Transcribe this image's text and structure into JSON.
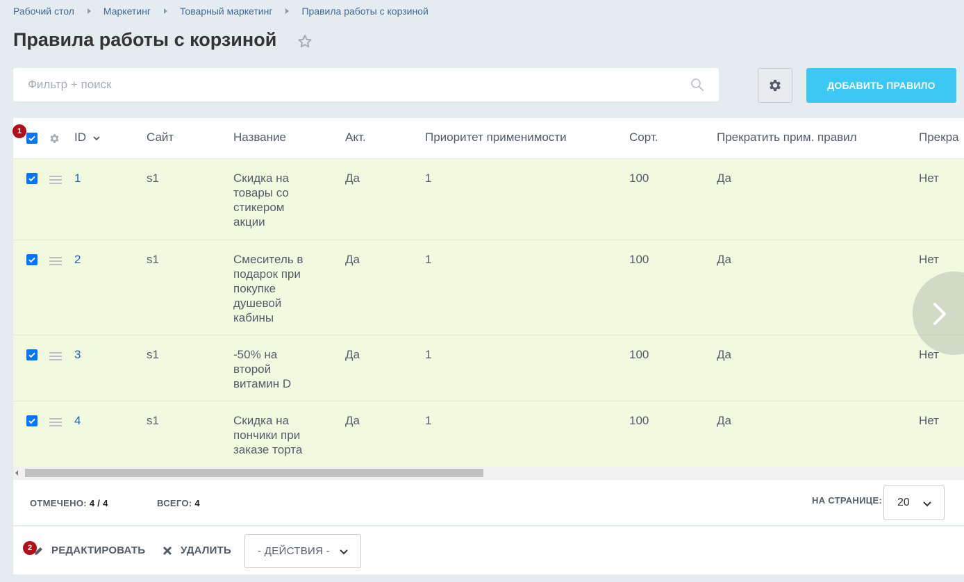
{
  "breadcrumb": [
    "Рабочий стол",
    "Маркетинг",
    "Товарный маркетинг",
    "Правила работы с корзиной"
  ],
  "title": "Правила работы с корзиной",
  "search": {
    "placeholder": "Фильтр + поиск"
  },
  "toolbar": {
    "add_label": "ДОБАВИТЬ ПРАВИЛО"
  },
  "grid": {
    "columns": [
      "ID",
      "Сайт",
      "Название",
      "Акт.",
      "Приоритет применимости",
      "Сорт.",
      "Прекратить прим. правил",
      "Прекра"
    ],
    "rows": [
      {
        "id": "1",
        "site": "s1",
        "name": "Скидка на товары со стикером акции",
        "active": "Да",
        "priority": "1",
        "sort": "100",
        "stop": "Да",
        "stop2": "Нет",
        "checked": true
      },
      {
        "id": "2",
        "site": "s1",
        "name": "Смеситель в подарок при покупке душевой кабины",
        "active": "Да",
        "priority": "1",
        "sort": "100",
        "stop": "Да",
        "stop2": "Нет",
        "checked": true
      },
      {
        "id": "3",
        "site": "s1",
        "name": "-50% на второй витамин D",
        "active": "Да",
        "priority": "1",
        "sort": "100",
        "stop": "Да",
        "stop2": "Нет",
        "checked": true
      },
      {
        "id": "4",
        "site": "s1",
        "name": "Скидка на пончики при заказе торта",
        "active": "Да",
        "priority": "1",
        "sort": "100",
        "stop": "Да",
        "stop2": "Нет",
        "checked": true
      }
    ]
  },
  "footer": {
    "checked_label": "ОТМЕЧЕНО:",
    "checked_value": "4 / 4",
    "total_label": "ВСЕГО:",
    "total_value": "4",
    "per_page_label": "НА СТРАНИЦЕ:",
    "per_page_value": "20"
  },
  "actions": {
    "edit_label": "РЕДАКТИРОВАТЬ",
    "delete_label": "УДАЛИТЬ",
    "select_label": "- ДЕЙСТВИЯ -"
  },
  "badges": [
    "1",
    "2"
  ],
  "colors": {
    "accent": "#3bc8f5",
    "row_bg": "#f1fadf",
    "link": "#2067b0",
    "badge": "#b0121b"
  }
}
